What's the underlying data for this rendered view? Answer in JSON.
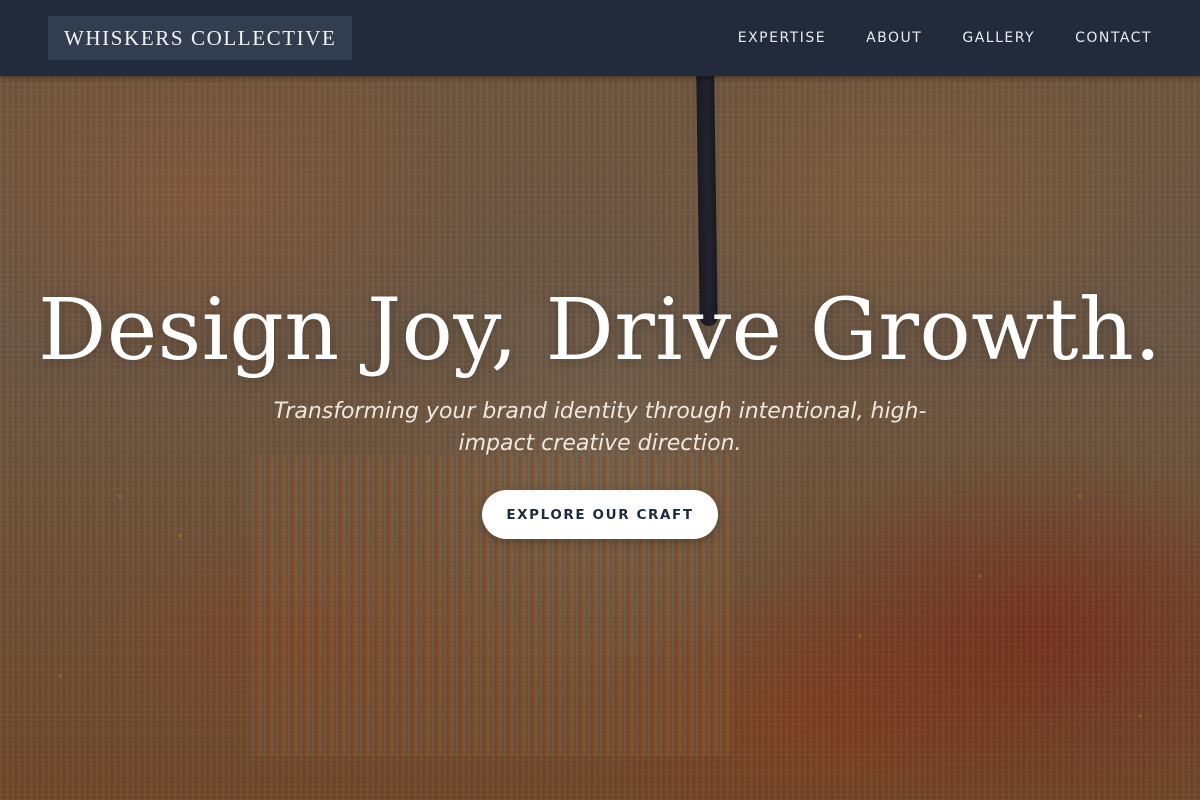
{
  "navbar": {
    "logo_text": "WHISKERS COLLECTIVE",
    "links": [
      {
        "label": "EXPERTISE"
      },
      {
        "label": "ABOUT"
      },
      {
        "label": "GALLERY"
      },
      {
        "label": "CONTACT"
      }
    ]
  },
  "hero": {
    "title": "Design Joy, Drive Growth.",
    "subtitle": "Transforming your brand identity through intentional, high-impact creative direction.",
    "cta_label": "EXPLORE OUR CRAFT"
  },
  "colors": {
    "navbar_bg": "#212b3c",
    "logo_bg": "#323e50",
    "cta_bg": "#ffffff",
    "cta_text": "#1f2a3d"
  }
}
